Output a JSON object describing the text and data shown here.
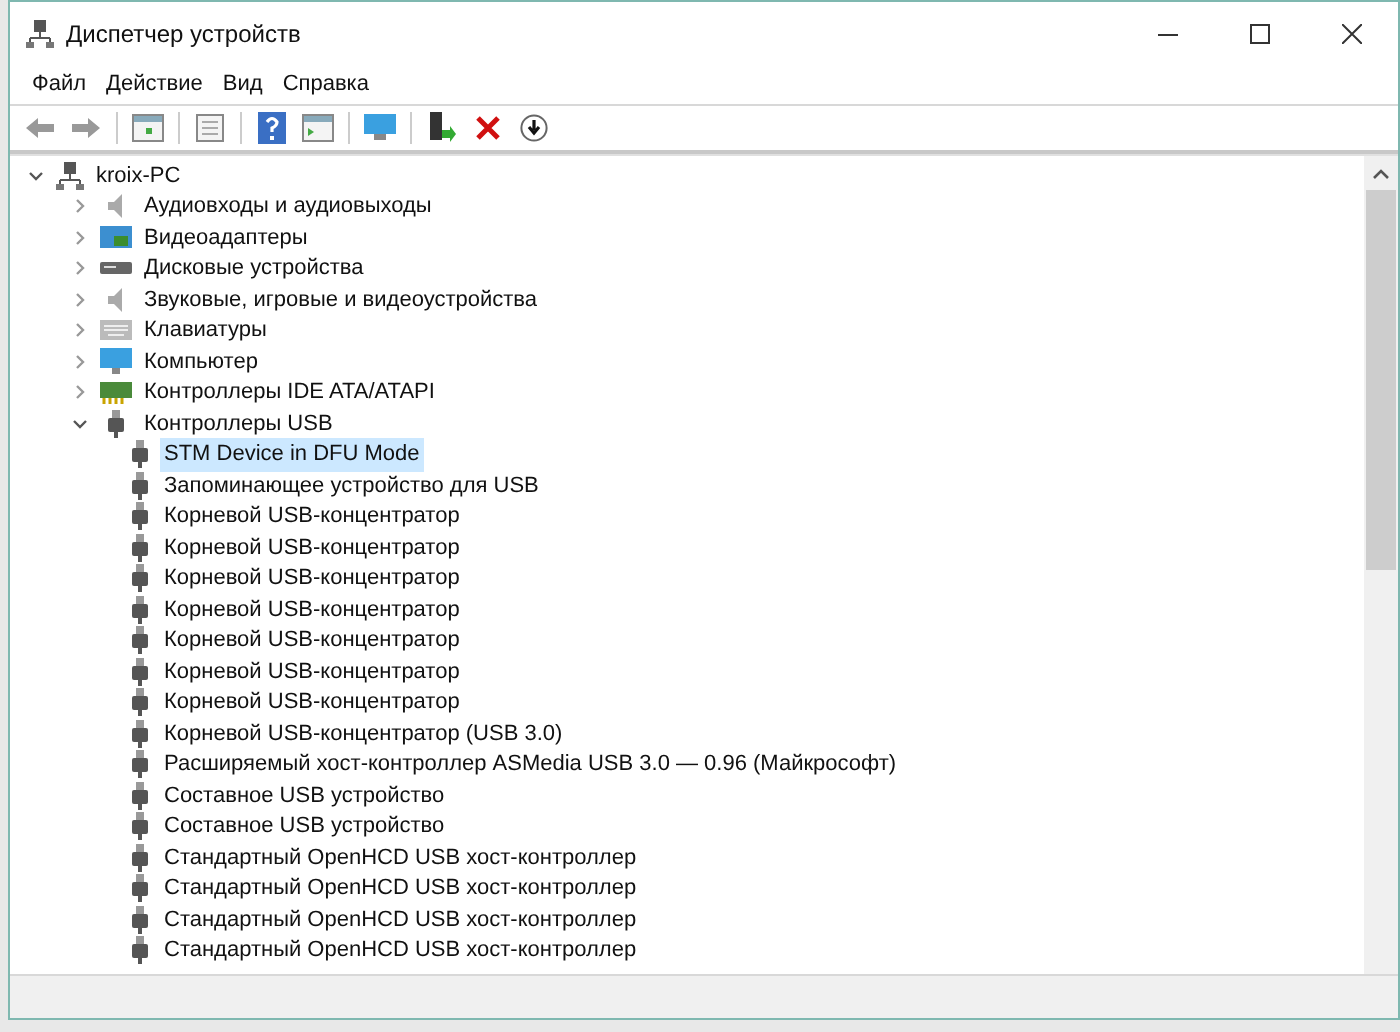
{
  "window": {
    "title": "Диспетчер устройств"
  },
  "menu": [
    "Файл",
    "Действие",
    "Вид",
    "Справка"
  ],
  "tree": {
    "label": "kroix-PC",
    "expanded": true,
    "children": [
      {
        "label": "Аудиовходы и аудиовыходы",
        "kind": "audio",
        "expanded": false
      },
      {
        "label": "Видеоадаптеры",
        "kind": "display",
        "expanded": false
      },
      {
        "label": "Дисковые устройства",
        "kind": "disk",
        "expanded": false
      },
      {
        "label": "Звуковые, игровые и видеоустройства",
        "kind": "audio",
        "expanded": false
      },
      {
        "label": "Клавиатуры",
        "kind": "keyboard",
        "expanded": false
      },
      {
        "label": "Компьютер",
        "kind": "computer",
        "expanded": false
      },
      {
        "label": "Контроллеры IDE ATA/ATAPI",
        "kind": "ide",
        "expanded": false
      },
      {
        "label": "Контроллеры USB",
        "kind": "usb",
        "expanded": true,
        "children": [
          {
            "label": "STM Device in DFU Mode",
            "selected": true
          },
          {
            "label": "Запоминающее устройство для USB",
            "selected": false
          },
          {
            "label": "Корневой USB-концентратор",
            "selected": false
          },
          {
            "label": "Корневой USB-концентратор",
            "selected": false
          },
          {
            "label": "Корневой USB-концентратор",
            "selected": false
          },
          {
            "label": "Корневой USB-концентратор",
            "selected": false
          },
          {
            "label": "Корневой USB-концентратор",
            "selected": false
          },
          {
            "label": "Корневой USB-концентратор",
            "selected": false
          },
          {
            "label": "Корневой USB-концентратор",
            "selected": false
          },
          {
            "label": "Корневой USB-концентратор (USB 3.0)",
            "selected": false
          },
          {
            "label": "Расширяемый хост-контроллер ASMedia USB 3.0 — 0.96 (Майкрософт)",
            "selected": false
          },
          {
            "label": "Составное USB устройство",
            "selected": false
          },
          {
            "label": "Составное USB устройство",
            "selected": false
          },
          {
            "label": "Стандартный OpenHCD USB хост-контроллер",
            "selected": false
          },
          {
            "label": "Стандартный OpenHCD USB хост-контроллер",
            "selected": false
          },
          {
            "label": "Стандартный OpenHCD USB хост-контроллер",
            "selected": false
          },
          {
            "label": "Стандартный OpenHCD USB хост-контроллер",
            "selected": false
          }
        ]
      }
    ]
  }
}
